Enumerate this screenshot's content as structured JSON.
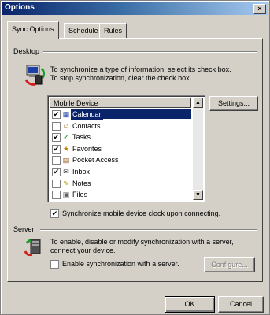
{
  "window": {
    "title": "Options",
    "close_label": "×"
  },
  "tabs": [
    {
      "label": "Sync Options",
      "active": true
    },
    {
      "label": "Schedule",
      "active": false
    },
    {
      "label": "Rules",
      "active": false
    }
  ],
  "desktop": {
    "group_label": "Desktop",
    "description_line1": "To synchronize a type of information, select its check box.",
    "description_line2": "To stop synchronization, clear the check box.",
    "list_header": "Mobile Device",
    "items": [
      {
        "label": "Calendar",
        "checked": true,
        "selected": true,
        "icon": "calendar-icon"
      },
      {
        "label": "Contacts",
        "checked": false,
        "selected": false,
        "icon": "contacts-icon"
      },
      {
        "label": "Tasks",
        "checked": true,
        "selected": false,
        "icon": "tasks-icon"
      },
      {
        "label": "Favorites",
        "checked": true,
        "selected": false,
        "icon": "favorites-icon"
      },
      {
        "label": "Pocket Access",
        "checked": false,
        "selected": false,
        "icon": "pocket-access-icon"
      },
      {
        "label": "Inbox",
        "checked": true,
        "selected": false,
        "icon": "inbox-icon"
      },
      {
        "label": "Notes",
        "checked": false,
        "selected": false,
        "icon": "notes-icon"
      },
      {
        "label": "Files",
        "checked": false,
        "selected": false,
        "icon": "files-icon"
      }
    ],
    "settings_button": "Settings...",
    "sync_clock_checked": true,
    "sync_clock_label": "Synchronize mobile device clock upon connecting."
  },
  "server": {
    "group_label": "Server",
    "description_line1": "To enable, disable or modify synchronization with a server,",
    "description_line2": "connect your device.",
    "enable_checked": false,
    "enable_label": "Enable synchronization with a server.",
    "configure_button": "Configure..."
  },
  "footer": {
    "ok_label": "OK",
    "cancel_label": "Cancel"
  },
  "colors": {
    "title_gradient_start": "#0a246a",
    "selection": "#0a246a",
    "face": "#d4d0c8"
  }
}
